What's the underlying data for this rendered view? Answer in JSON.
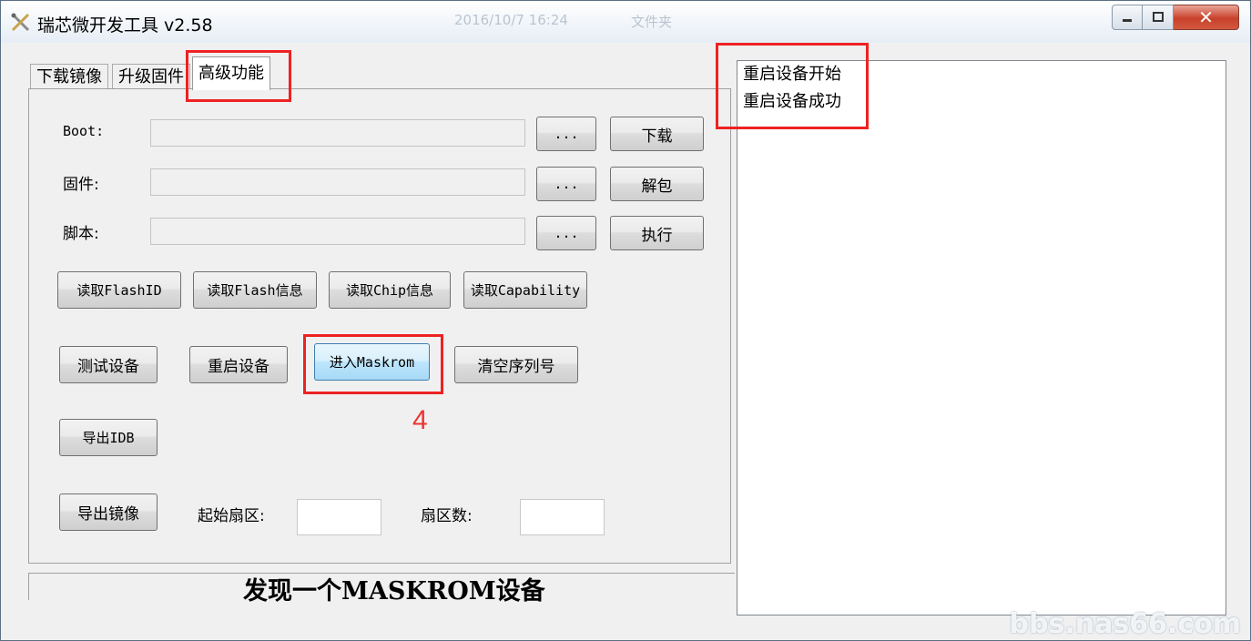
{
  "window": {
    "title": "瑞芯微开发工具 v2.58",
    "ghost_date": "2016/10/7 16:24",
    "ghost_label": "文件夹"
  },
  "tabs": [
    {
      "label": "下载镜像"
    },
    {
      "label": "升级固件"
    },
    {
      "label": "高级功能"
    }
  ],
  "rows": {
    "boot": {
      "label": "Boot:",
      "browse": "...",
      "action": "下载"
    },
    "firmware": {
      "label": "固件:",
      "browse": "...",
      "action": "解包"
    },
    "script": {
      "label": "脚本:",
      "browse": "...",
      "action": "执行"
    }
  },
  "buttons": {
    "read_flash_id": "读取FlashID",
    "read_flash_info": "读取Flash信息",
    "read_chip_info": "读取Chip信息",
    "read_capability": "读取Capability",
    "test_device": "测试设备",
    "reboot_device": "重启设备",
    "enter_maskrom": "进入Maskrom",
    "clear_serial": "清空序列号",
    "export_idb": "导出IDB",
    "export_image": "导出镜像"
  },
  "sector": {
    "start_label": "起始扇区:",
    "start_value": "",
    "count_label": "扇区数:",
    "count_value": ""
  },
  "status": "发现一个MASKROM设备",
  "log": [
    "重启设备开始",
    "重启设备成功"
  ],
  "annotation": {
    "step": "4"
  },
  "watermark": "bbs.nas66.com",
  "colors": {
    "annotation_red": "#ee2222"
  }
}
